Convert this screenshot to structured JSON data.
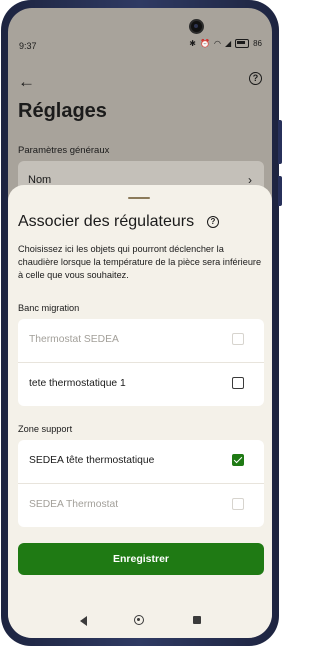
{
  "status_bar": {
    "time": "9:37",
    "battery": "86"
  },
  "header": {
    "title": "Réglages",
    "section_label": "Paramètres généraux",
    "name_row_label": "Nom"
  },
  "sheet": {
    "title": "Associer des régulateurs",
    "description": "Choisissez ici les objets qui pourront déclencher la chaudière lorsque la température de la pièce sera inférieure à celle que vous souhaitez.",
    "groups": [
      {
        "label": "Banc migration",
        "items": [
          {
            "label": "Thermostat SEDEA",
            "enabled": false,
            "checked": false
          },
          {
            "label": "tete thermostatique 1",
            "enabled": true,
            "checked": false
          }
        ]
      },
      {
        "label": "Zone support",
        "items": [
          {
            "label": "SEDEA tête thermostatique",
            "enabled": true,
            "checked": true
          },
          {
            "label": "SEDEA Thermostat",
            "enabled": false,
            "checked": false
          }
        ]
      }
    ],
    "save_label": "Enregistrer"
  },
  "colors": {
    "accent": "#1f7a14",
    "sheet_bg": "#f4f1e9",
    "scrim_bg": "#a8a39b"
  },
  "icons": {
    "back": "arrow-left-icon",
    "help": "question-circle-icon",
    "chevron": "chevron-right-icon"
  }
}
